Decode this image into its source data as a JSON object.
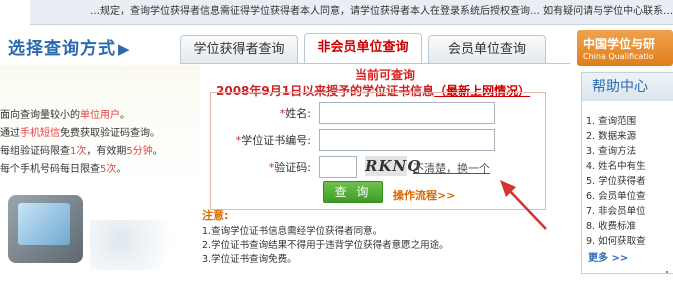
{
  "topbar": {
    "text": "…规定，查询学位获得者信息需征得学位获得者本人同意，请学位获得者本人在登录系统后授权查询… 如有疑问请与学位中心联系…"
  },
  "header": {
    "title": "选择查询方式",
    "arrow": "▶"
  },
  "tabs": [
    {
      "label": "学位获得者查询",
      "active": false
    },
    {
      "label": "非会员单位查询",
      "active": true
    },
    {
      "label": "会员单位查询",
      "active": false
    }
  ],
  "left_panel": {
    "lines": [
      {
        "pre": "面向查询量较小的",
        "hl": "单位用户",
        "post": "。"
      },
      {
        "pre": "通过",
        "hl": "手机短信",
        "post": "免费获取验证码查询。"
      },
      {
        "pre": "每组验证码限查",
        "hl": "1次",
        "post": "，有效期",
        "hl2": "5分钟",
        "post2": "。"
      },
      {
        "pre": "每个手机号码每日限查",
        "hl": "5次",
        "post": "。"
      }
    ]
  },
  "form": {
    "available_label": "当前可查询",
    "since_text": "2008年9月1日以来授予的学位证书信息",
    "since_link": "（最新上网情况）",
    "name_label": "姓名:",
    "cert_label": "学位证书编号:",
    "code_label": "验证码:",
    "star": "*",
    "name_value": "",
    "cert_value": "",
    "code_value": "",
    "captcha_text": "RKNQ",
    "refresh_link": "不清楚，换一个",
    "submit_label": "查 询",
    "flow_link": "操作流程>>"
  },
  "notes": {
    "heading": "注意:",
    "items": [
      "1.查询学位证书信息需经学位获得者同意。",
      "2.学位证书查询结果不得用于违背学位获得者意愿之用途。",
      "3.学位证书查询免费。"
    ]
  },
  "brand": {
    "cn": "中国学位与研",
    "en": "China Qualificatio"
  },
  "help": {
    "title": "帮助中心",
    "items": [
      "1. 查询范围",
      "2. 数据来源",
      "3. 查询方法",
      "4. 姓名中有生",
      "5. 学位获得者",
      "6. 会员单位查",
      "7. 非会员单位",
      "8. 收费标准",
      "9. 如何获取查"
    ],
    "more": "更多 >>"
  },
  "colors": {
    "accent": "#2a6bb0",
    "alert": "#d22222",
    "button": "#4aa82f",
    "arrow": "#d33333"
  }
}
